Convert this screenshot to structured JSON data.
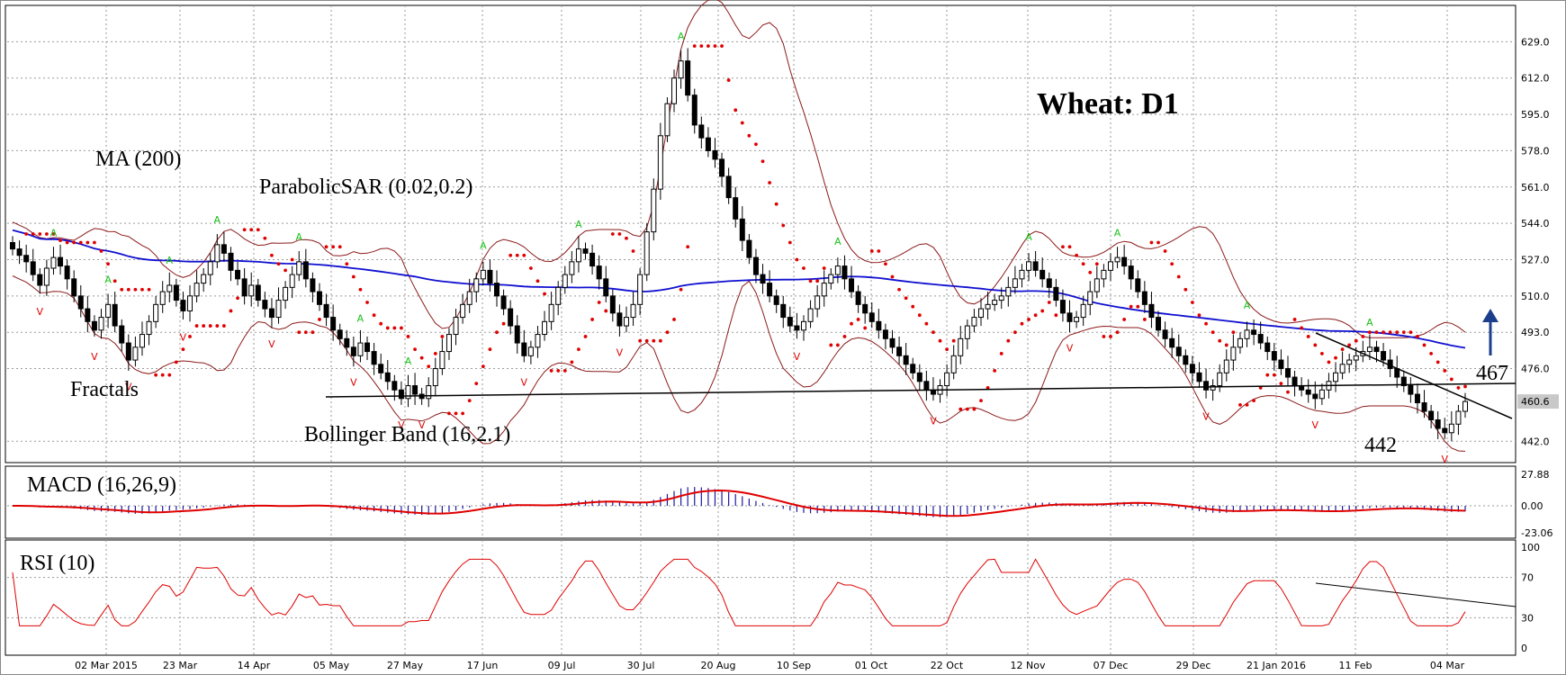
{
  "chart_data": {
    "type": "candlestick",
    "title": "Wheat: D1",
    "x_tick_labels": [
      "02 Mar 2015",
      "23 Mar",
      "14 Apr",
      "05 May",
      "27 May",
      "17 Jun",
      "09 Jul",
      "30 Jul",
      "20 Aug",
      "10 Sep",
      "01 Oct",
      "22 Oct",
      "12 Nov",
      "07 Dec",
      "29 Dec",
      "21 Jan 2016",
      "11 Feb",
      "04 Mar"
    ],
    "price_axis": {
      "ylim": [
        432,
        646
      ],
      "ticks": [
        "629.0",
        "612.0",
        "595.0",
        "578.0",
        "561.0",
        "544.0",
        "527.0",
        "510.0",
        "493.0",
        "476.0",
        "442.0"
      ],
      "current_price": "460.6"
    },
    "ohlc_close": [
      532,
      529,
      526,
      520,
      515,
      523,
      528,
      524,
      518,
      510,
      504,
      498,
      494,
      500,
      506,
      496,
      488,
      480,
      486,
      492,
      498,
      506,
      512,
      515,
      508,
      503,
      510,
      516,
      520,
      526,
      534,
      530,
      522,
      518,
      510,
      515,
      508,
      504,
      500,
      508,
      514,
      520,
      526,
      518,
      512,
      506,
      500,
      494,
      490,
      486,
      482,
      488,
      484,
      478,
      474,
      470,
      466,
      462,
      468,
      464,
      462,
      468,
      476,
      484,
      492,
      500,
      506,
      512,
      518,
      522,
      516,
      510,
      504,
      496,
      488,
      482,
      486,
      492,
      498,
      506,
      514,
      520,
      526,
      532,
      530,
      524,
      518,
      510,
      502,
      496,
      500,
      506,
      520,
      540,
      560,
      585,
      600,
      612,
      620,
      604,
      590,
      584,
      578,
      574,
      566,
      556,
      546,
      536,
      528,
      520,
      516,
      510,
      506,
      500,
      496,
      494,
      498,
      504,
      510,
      516,
      520,
      524,
      518,
      512,
      506,
      502,
      498,
      494,
      490,
      486,
      482,
      478,
      474,
      470,
      466,
      464,
      468,
      474,
      482,
      490,
      496,
      500,
      504,
      506,
      508,
      510,
      514,
      518,
      522,
      526,
      522,
      518,
      514,
      508,
      502,
      498,
      500,
      506,
      512,
      518,
      522,
      526,
      528,
      524,
      518,
      512,
      506,
      500,
      494,
      490,
      486,
      482,
      478,
      474,
      470,
      466,
      468,
      474,
      480,
      486,
      490,
      494,
      492,
      488,
      484,
      480,
      476,
      472,
      468,
      466,
      464,
      462,
      466,
      470,
      474,
      478,
      480,
      482,
      484,
      486,
      484,
      480,
      476,
      472,
      468,
      464,
      460,
      456,
      452,
      448,
      446,
      450,
      456,
      460.6
    ],
    "indicators": {
      "ma": {
        "label": "MA (200)",
        "color": "#1010d0"
      },
      "psar": {
        "label": "ParabolicSAR (0.02,0.2)",
        "color": "#e00000"
      },
      "bollinger": {
        "label": "Bollinger Band (16,2.1)",
        "color": "#8b1a1a"
      },
      "fractals": {
        "label": "Fractals",
        "up_color": "#18c018",
        "down_color": "#e00000",
        "up_glyph": "A",
        "down_glyph": "V"
      }
    },
    "annotations": [
      {
        "text": "467"
      },
      {
        "text": "442"
      }
    ],
    "macd": {
      "label": "MACD (16,26,9)",
      "ticks": [
        "27.88",
        "0.00",
        "-23.06"
      ]
    },
    "rsi": {
      "label": "RSI (10)",
      "ticks": [
        "100",
        "70",
        "30",
        "0"
      ]
    }
  }
}
